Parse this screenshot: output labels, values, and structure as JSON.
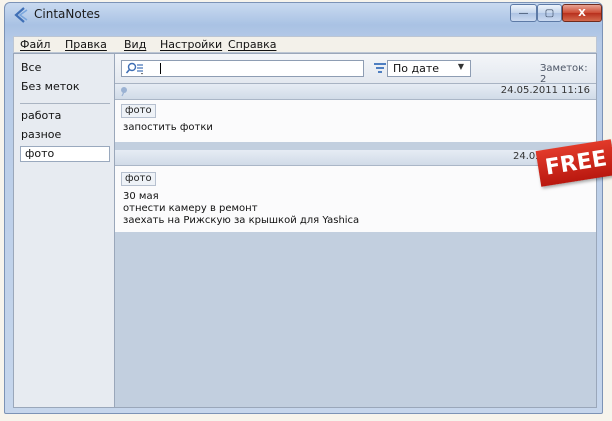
{
  "window": {
    "title": "CintaNotes",
    "min_glyph": "—",
    "max_glyph": "▢",
    "close_glyph": "X"
  },
  "menu": {
    "items": [
      {
        "label": "Файл"
      },
      {
        "label": "Правка"
      },
      {
        "label": "Вид"
      },
      {
        "label": "Настройки"
      },
      {
        "label": "Справка"
      }
    ]
  },
  "sidebar": {
    "items": [
      {
        "label": "Все"
      },
      {
        "label": "Без меток"
      },
      {
        "label": "работа"
      },
      {
        "label": "разное"
      },
      {
        "label": "фото",
        "selected": true
      }
    ]
  },
  "toolbar": {
    "search_value": "",
    "sort_label": "По дате",
    "note_count": "Заметок: 2"
  },
  "notes": [
    {
      "date": "24.05.2011 11:16",
      "tag": "фото",
      "lines": [
        "запостить фотки"
      ]
    },
    {
      "date": "24.05.2011 1",
      "tag": "фото",
      "lines": [
        "30 мая",
        "отнести камеру в ремонт",
        "заехать на Рижскую за крышкой для Yashica"
      ]
    }
  ],
  "badge": {
    "label": "FREE",
    "color": "#d02818"
  },
  "colors": {
    "title_bar": "#b7cbe7",
    "selection": "#ffffff",
    "notes_background": "#c2cfdf"
  }
}
